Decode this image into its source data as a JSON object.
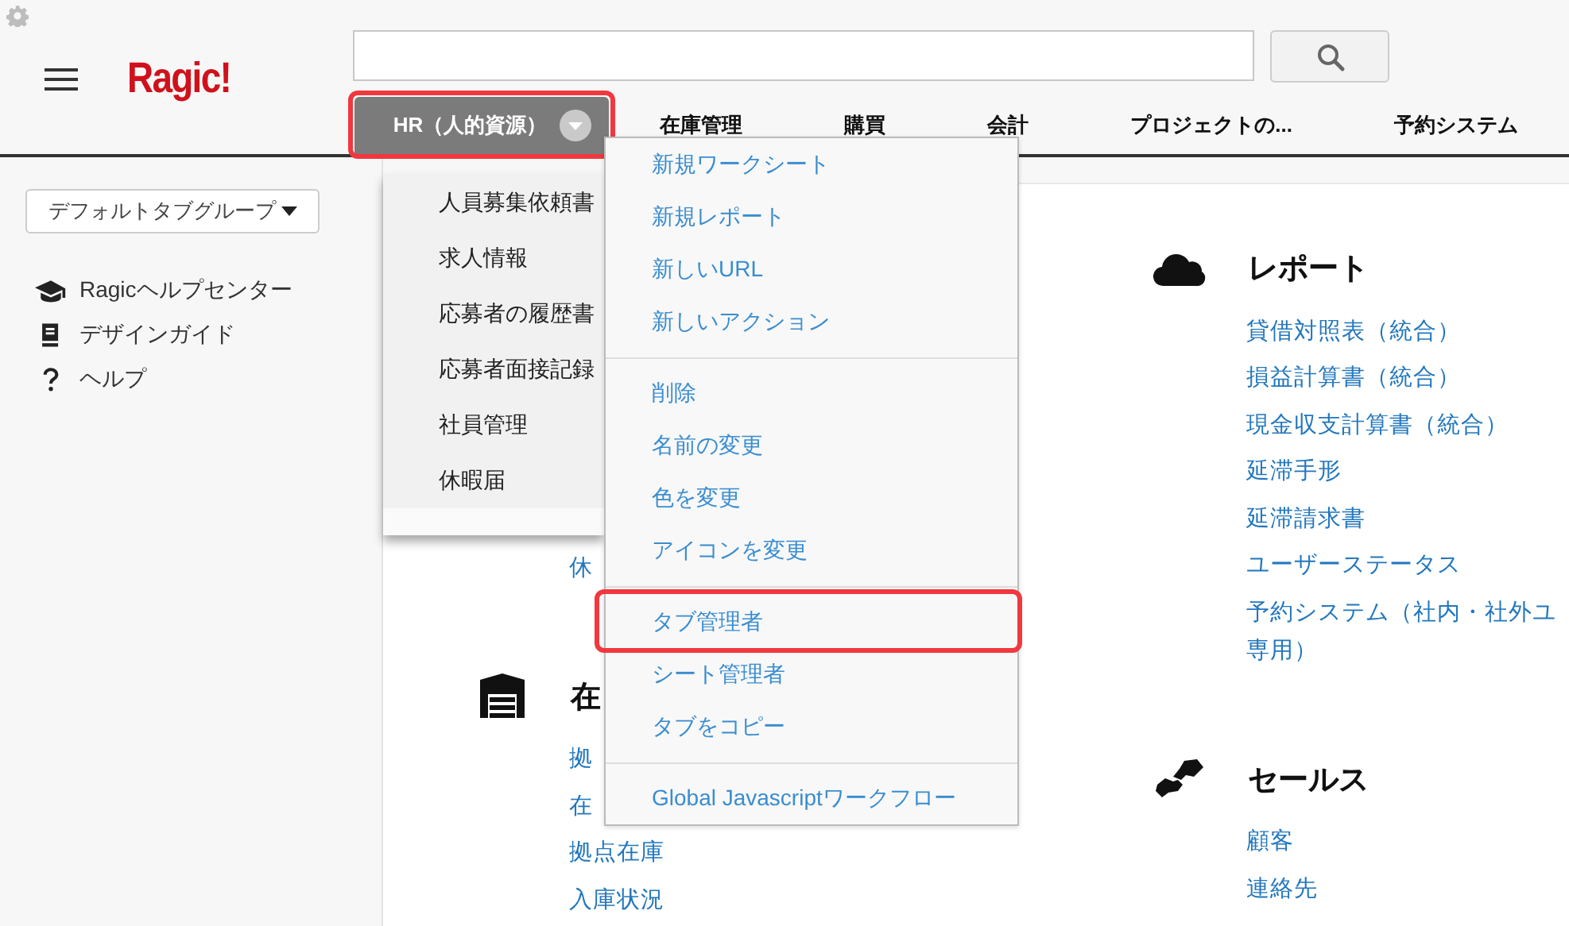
{
  "header": {
    "logo": "Ragic!"
  },
  "tabs": [
    {
      "label": "HR（人的資源）",
      "selected": true,
      "highlighted": true
    },
    {
      "label": "在庫管理",
      "selected": false,
      "highlighted": false
    },
    {
      "label": "購買",
      "selected": false,
      "highlighted": false
    },
    {
      "label": "会計",
      "selected": false,
      "highlighted": false
    },
    {
      "label": "プロジェクトの...",
      "selected": false,
      "highlighted": false
    },
    {
      "label": "予約システム",
      "selected": false,
      "highlighted": false
    }
  ],
  "sidebar": {
    "group_selector": "デフォルトタブグループ",
    "links": [
      "Ragicヘルプセンター",
      "デザインガイド",
      "ヘルプ"
    ]
  },
  "main": {
    "columns": [
      {
        "sections": [
          {
            "links": [
              "休"
            ]
          },
          {
            "title": "在",
            "links": [
              "拠",
              "在",
              "拠点在庫",
              "入庫状況"
            ]
          }
        ]
      },
      {
        "sections": [
          {
            "title": "レポート",
            "links": [
              "貸借対照表（統合）",
              "損益計算書（統合）",
              "現金収支計算書（統合）",
              "延滞手形",
              "延滞請求書",
              "ユーザーステータス",
              "予約システム（社内・社外ユ専用）"
            ]
          },
          {
            "title": "セールス",
            "links": [
              "顧客",
              "連絡先"
            ]
          }
        ]
      }
    ]
  },
  "tab_menu": {
    "items": [
      "人員募集依頼書",
      "求人情報",
      "応募者の履歴書",
      "応募者面接記録",
      "社員管理",
      "休暇届"
    ]
  },
  "context_menu": {
    "groups": [
      [
        {
          "label": "新規ワークシート",
          "highlighted": false
        },
        {
          "label": "新規レポート",
          "highlighted": false
        },
        {
          "label": "新しいURL",
          "highlighted": false
        },
        {
          "label": "新しいアクション",
          "highlighted": false
        }
      ],
      [
        {
          "label": "削除",
          "highlighted": false
        },
        {
          "label": "名前の変更",
          "highlighted": false
        },
        {
          "label": "色を変更",
          "highlighted": false
        },
        {
          "label": "アイコンを変更",
          "highlighted": false
        }
      ],
      [
        {
          "label": "タブ管理者",
          "highlighted": true
        },
        {
          "label": "シート管理者",
          "highlighted": false
        },
        {
          "label": "タブをコピー",
          "highlighted": false
        }
      ],
      [
        {
          "label": "Global Javascriptワークフロー",
          "highlighted": false
        }
      ]
    ]
  }
}
